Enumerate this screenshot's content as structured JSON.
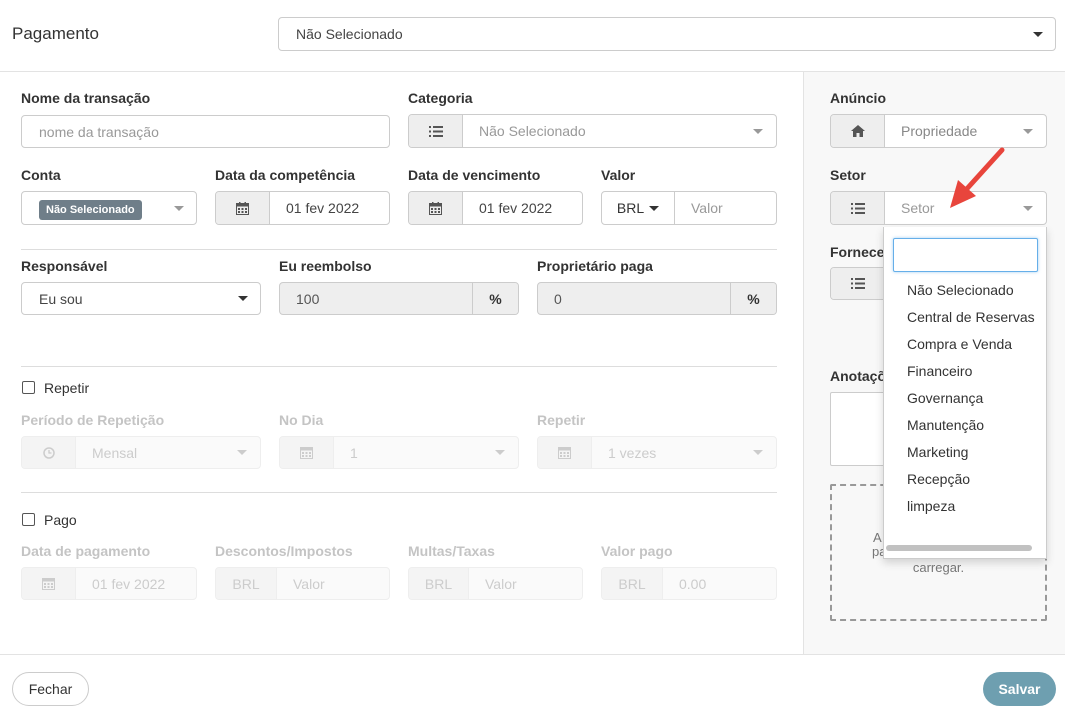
{
  "header": {
    "title": "Pagamento",
    "payment_select": "Não Selecionado"
  },
  "form": {
    "nome_label": "Nome da transação",
    "nome_placeholder": "nome da transação",
    "categoria_label": "Categoria",
    "categoria_value": "Não Selecionado",
    "conta_label": "Conta",
    "conta_badge": "Não Selecionado",
    "competencia_label": "Data da competência",
    "competencia_value": "01 fev 2022",
    "vencimento_label": "Data de vencimento",
    "vencimento_value": "01 fev 2022",
    "valor_label": "Valor",
    "valor_currency": "BRL",
    "valor_placeholder": "Valor",
    "responsavel_label": "Responsável",
    "responsavel_value": "Eu sou",
    "reembolso_label": "Eu reembolso",
    "reembolso_value": "100",
    "proprietario_label": "Proprietário paga",
    "proprietario_value": "0",
    "percent_symbol": "%"
  },
  "repeat": {
    "checkbox_label": "Repetir",
    "periodo_label": "Período de Repetição",
    "periodo_value": "Mensal",
    "dia_label": "No Dia",
    "dia_value": "1",
    "repetir_label": "Repetir",
    "repetir_value": "1 vezes"
  },
  "paid": {
    "checkbox_label": "Pago",
    "data_label": "Data de pagamento",
    "data_value": "01 fev 2022",
    "descontos_label": "Descontos/Impostos",
    "multas_label": "Multas/Taxas",
    "valor_pago_label": "Valor pago",
    "currency": "BRL",
    "valor_placeholder": "Valor",
    "valor_pago_value": "0.00"
  },
  "side": {
    "anuncio_label": "Anúncio",
    "anuncio_value": "Propriedade",
    "setor_label": "Setor",
    "setor_value": "Setor",
    "fornecedor_label": "Fornece",
    "anotacoes_label": "Anotaçõ",
    "upload_line1_left": "A",
    "upload_line2_left": "pa",
    "upload_line3": "carregar."
  },
  "setor_dropdown": {
    "options": [
      "Não Selecionado",
      "Central de Reservas",
      "Compra e Venda",
      "Financeiro",
      "Governança",
      "Manutenção",
      "Marketing",
      "Recepção",
      "limpeza"
    ]
  },
  "footer": {
    "close_label": "Fechar",
    "save_label": "Salvar"
  },
  "colors": {
    "save_button": "#6e9fb0",
    "badge": "#6f7e89",
    "arrow": "#e8453c"
  }
}
